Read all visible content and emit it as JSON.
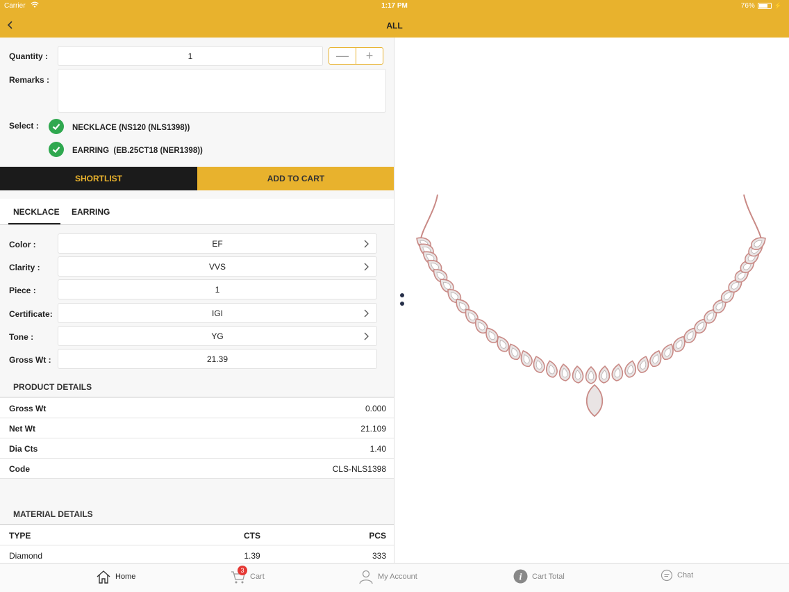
{
  "status": {
    "carrier": "Carrier",
    "time": "1:17 PM",
    "battery": "76%",
    "battery_level": 0.76
  },
  "nav": {
    "title": "ALL"
  },
  "form": {
    "quantity_label": "Quantity :",
    "quantity_value": "1",
    "remarks_label": "Remarks :",
    "remarks_value": "",
    "select_label": "Select :",
    "selections": [
      "NECKLACE (NS120 (NLS1398))",
      "EARRING  (EB.25CT18 (NER1398))"
    ]
  },
  "actions": {
    "shortlist": "SHORTLIST",
    "add_to_cart": "ADD TO CART"
  },
  "tabs": [
    "NECKLACE",
    "EARRING"
  ],
  "options": [
    {
      "label": "Color :",
      "value": "EF"
    },
    {
      "label": "Clarity :",
      "value": "VVS"
    },
    {
      "label": "Piece :",
      "value": "1"
    },
    {
      "label": "Certificate:",
      "value": "IGI"
    },
    {
      "label": "Tone :",
      "value": "YG"
    },
    {
      "label": "Gross Wt :",
      "value": "21.39"
    }
  ],
  "product_details": {
    "heading": "PRODUCT DETAILS",
    "rows": [
      {
        "key": "Gross Wt",
        "value": "0.000"
      },
      {
        "key": "Net Wt",
        "value": "21.109"
      },
      {
        "key": "Dia Cts",
        "value": "1.40"
      },
      {
        "key": "Code",
        "value": "CLS-NLS1398"
      }
    ]
  },
  "material_details": {
    "heading": "MATERIAL DETAILS",
    "columns": [
      "TYPE",
      "CTS",
      "PCS"
    ],
    "rows": [
      {
        "type": "Diamond",
        "cts": "1.39",
        "pcs": "333"
      }
    ]
  },
  "tabbar": {
    "home": "Home",
    "cart": "Cart",
    "cart_badge": "3",
    "account": "My Account",
    "cart_total": "Cart Total",
    "chat": "Chat"
  },
  "colors": {
    "accent": "#e8b22d",
    "dark": "#1b1b1b",
    "check": "#2fa84f",
    "badge": "#e53935",
    "necklace_metal": "#c98a86"
  }
}
